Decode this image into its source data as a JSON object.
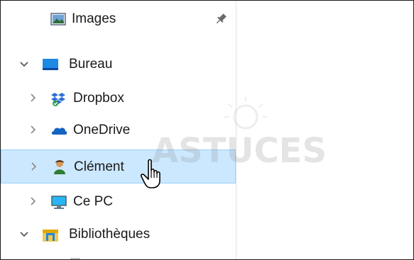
{
  "nav": {
    "items": [
      {
        "label": "Images",
        "icon": "images-icon",
        "expanded": null,
        "pinned": true
      },
      {
        "label": "Bureau",
        "icon": "desktop-folder-icon",
        "expanded": true
      },
      {
        "label": "Dropbox",
        "icon": "dropbox-icon",
        "expanded": false
      },
      {
        "label": "OneDrive",
        "icon": "onedrive-icon",
        "expanded": false
      },
      {
        "label": "Clément",
        "icon": "user-folder-icon",
        "expanded": false,
        "selected": true
      },
      {
        "label": "Ce PC",
        "icon": "this-pc-icon",
        "expanded": false
      },
      {
        "label": "Bibliothèques",
        "icon": "libraries-icon",
        "expanded": true
      }
    ]
  },
  "watermark": {
    "text": "ASTUCES"
  },
  "colors": {
    "selection_bg": "#cce8ff",
    "selection_border": "#99d1ff",
    "desktop_blue": "#1e88e5",
    "dropbox_blue": "#2b6fd8",
    "onedrive_blue": "#1565c0",
    "libraries_yellow": "#f2c94c"
  }
}
